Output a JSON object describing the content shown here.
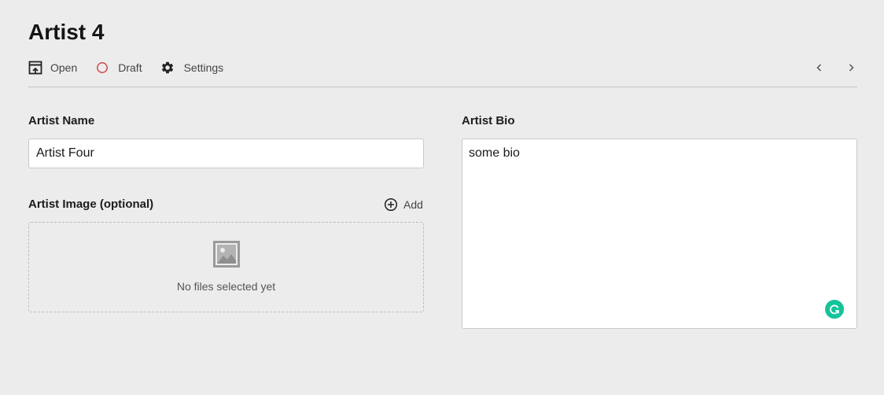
{
  "page": {
    "title": "Artist 4"
  },
  "toolbar": {
    "open_label": "Open",
    "open_icon": "preview-window-icon",
    "draft_label": "Draft",
    "draft_icon": "circle-outline-icon",
    "draft_color": "#d0484f",
    "settings_label": "Settings",
    "settings_icon": "gear-icon",
    "prev_icon": "chevron-left-icon",
    "next_icon": "chevron-right-icon"
  },
  "form": {
    "name": {
      "label": "Artist Name",
      "value": "Artist Four"
    },
    "image": {
      "label": "Artist Image (optional)",
      "add_label": "Add",
      "add_icon": "plus-circle-icon",
      "empty_text": "No files selected yet",
      "placeholder_icon": "image-icon"
    },
    "bio": {
      "label": "Artist Bio",
      "value": "some bio"
    }
  },
  "widgets": {
    "grammarly_icon": "grammarly-icon",
    "grammarly_color": "#15c39a"
  }
}
